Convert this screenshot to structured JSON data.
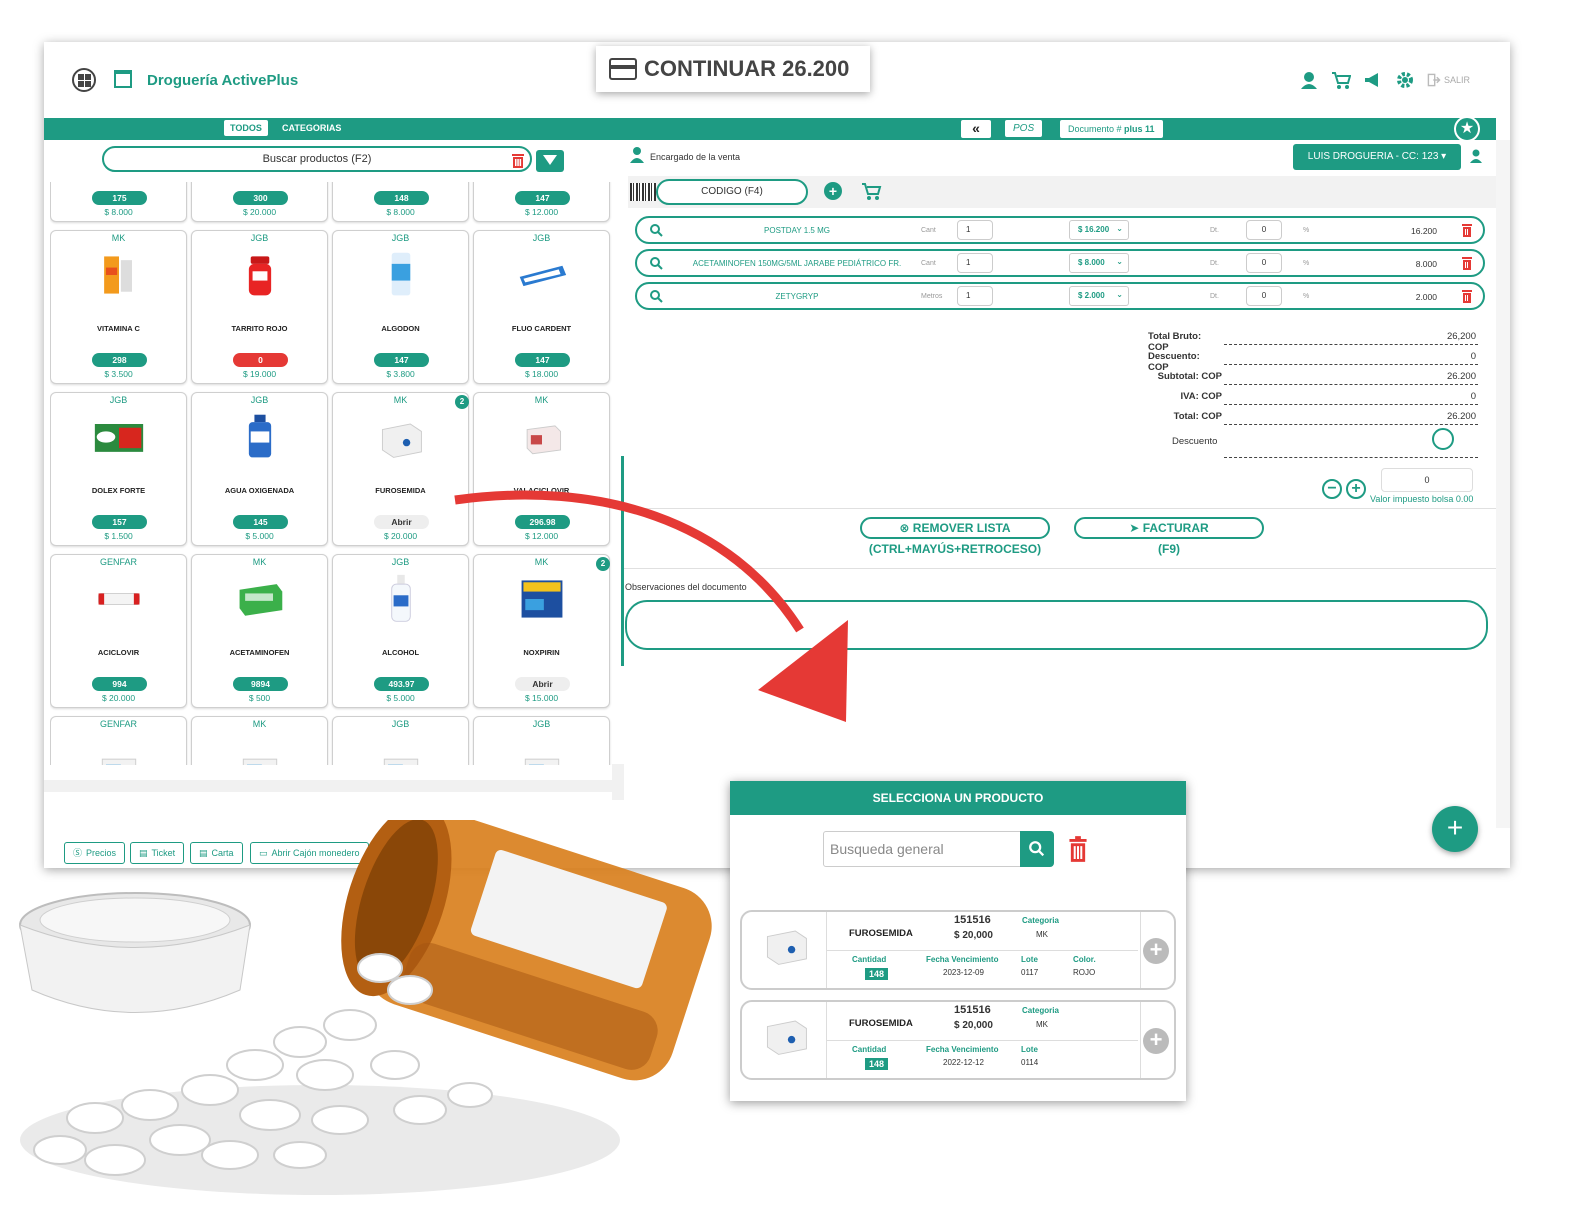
{
  "continuar": {
    "label": "CONTINUAR 26.200"
  },
  "app": {
    "name": "Droguería ActivePlus",
    "salir": "SALIR"
  },
  "tabs": {
    "todos": "TODOS",
    "categorias": "CATEGORIAS"
  },
  "toolbar": {
    "back": "«",
    "pos": "POS",
    "doc_prefix": "Documento #",
    "doc_value": "plus 11"
  },
  "search": {
    "placeholder": "Buscar productos (F2)"
  },
  "top_row": [
    {
      "stock": "175",
      "price": "$ 8.000"
    },
    {
      "stock": "300",
      "price": "$ 20.000"
    },
    {
      "stock": "148",
      "price": "$ 8.000"
    },
    {
      "stock": "147",
      "price": "$ 12.000"
    }
  ],
  "products": [
    {
      "brand": "MK",
      "name": "VITAMINA C",
      "stock": "298",
      "price": "$ 3.500",
      "img": "orange-box"
    },
    {
      "brand": "JGB",
      "name": "TARRITO ROJO",
      "stock": "0",
      "price": "$ 19.000",
      "img": "red-jar"
    },
    {
      "brand": "JGB",
      "name": "ALGODON",
      "stock": "147",
      "price": "$ 3.800",
      "img": "cotton-bag"
    },
    {
      "brand": "JGB",
      "name": "FLUO CARDENT",
      "stock": "147",
      "price": "$ 18.000",
      "img": "toothpaste"
    },
    {
      "brand": "JGB",
      "name": "DOLEX FORTE",
      "stock": "157",
      "price": "$ 1.500",
      "img": "dolex-box"
    },
    {
      "brand": "JGB",
      "name": "AGUA OXIGENADA",
      "stock": "145",
      "price": "$ 5.000",
      "img": "blue-bottle"
    },
    {
      "brand": "MK",
      "name": "FUROSEMIDA",
      "stock": "Abrir",
      "price": "$ 20.000",
      "img": "white-box",
      "badge": "2"
    },
    {
      "brand": "MK",
      "name": "VALACICLOVIR",
      "stock": "296.98",
      "price": "$ 12.000",
      "img": "pink-box"
    },
    {
      "brand": "GENFAR",
      "name": "ACICLOVIR",
      "stock": "994",
      "price": "$ 20.000",
      "img": "tube"
    },
    {
      "brand": "MK",
      "name": "ACETAMINOFEN",
      "stock": "9894",
      "price": "$ 500",
      "img": "green-box"
    },
    {
      "brand": "JGB",
      "name": "ALCOHOL",
      "stock": "493.97",
      "price": "$ 5.000",
      "img": "alcohol-bottle"
    },
    {
      "brand": "MK",
      "name": "NOXPIRIN",
      "stock": "Abrir",
      "price": "$ 15.000",
      "img": "noxpirin-box",
      "badge": "2"
    },
    {
      "brand": "GENFAR",
      "name": "",
      "stock": "",
      "price": "",
      "img": "box"
    },
    {
      "brand": "MK",
      "name": "",
      "stock": "",
      "price": "",
      "img": "box"
    },
    {
      "brand": "JGB",
      "name": "",
      "stock": "",
      "price": "",
      "img": "box"
    },
    {
      "brand": "JGB",
      "name": "",
      "stock": "",
      "price": "",
      "img": "box"
    }
  ],
  "sale": {
    "encargado_label": "Encargado de la venta",
    "seller": "LUIS DROGUERIA - CC: 123",
    "codigo_placeholder": "CODIGO (F4)",
    "lines": [
      {
        "name": "POSTDAY 1.5 MG",
        "unit": "Cant",
        "qty": "1",
        "price": "$ 16.200",
        "dt": "Dt.",
        "discount": "0",
        "pct": "%",
        "total": "16.200"
      },
      {
        "name": "ACETAMINOFEN 150MG/5ML JARABE PEDIÁTRICO FR.",
        "unit": "Cant",
        "qty": "1",
        "price": "$ 8.000",
        "dt": "Dt.",
        "discount": "0",
        "pct": "%",
        "total": "8.000"
      },
      {
        "name": "ZETYGRYP",
        "unit": "Metros",
        "qty": "1",
        "price": "$ 2.000",
        "dt": "Dt.",
        "discount": "0",
        "pct": "%",
        "total": "2.000"
      }
    ],
    "totals": [
      {
        "label": "Total Bruto: COP",
        "value": "26,200"
      },
      {
        "label": "Descuento: COP",
        "value": "0"
      },
      {
        "label": "Subtotal: COP",
        "value": "26.200"
      },
      {
        "label": "IVA: COP",
        "value": "0"
      },
      {
        "label": "Total: COP",
        "value": "26.200"
      }
    ],
    "descuento_label": "Descuento",
    "bolsa_value": "0",
    "bolsa_label": "Valor impuesto bolsa 0.00",
    "remover_label": "REMOVER LISTA",
    "remover_shortcut": "(CTRL+MAYÚS+RETROCESO)",
    "facturar_label": "FACTURAR",
    "facturar_shortcut": "(F9)",
    "obs_label": "Observaciones del documento"
  },
  "bottom_buttons": [
    "Precios",
    "Ticket",
    "Carta",
    "Abrir Cajón monedero"
  ],
  "modal": {
    "title": "SELECCIONA UN PRODUCTO",
    "search_placeholder": "Busqueda general",
    "items": [
      {
        "name": "FUROSEMIDA",
        "code": "151516",
        "price": "$ 20,000",
        "cat_label": "Categoria",
        "cat": "MK",
        "qty_label": "Cantidad",
        "qty": "148",
        "venc_label": "Fecha Vencimiento",
        "venc": "2023-12-09",
        "lote_label": "Lote",
        "lote": "0117",
        "color_label": "Color.",
        "color": "ROJO"
      },
      {
        "name": "FUROSEMIDA",
        "code": "151516",
        "price": "$ 20,000",
        "cat_label": "Categoria",
        "cat": "MK",
        "qty_label": "Cantidad",
        "qty": "148",
        "venc_label": "Fecha Vencimiento",
        "venc": "2022-12-12",
        "lote_label": "Lote",
        "lote": "0114",
        "color_label": "",
        "color": ""
      }
    ]
  },
  "colors": {
    "accent": "#1e9b83",
    "danger": "#e53935",
    "arrow": "#e53935",
    "pill_bottle": "#d9801e"
  }
}
